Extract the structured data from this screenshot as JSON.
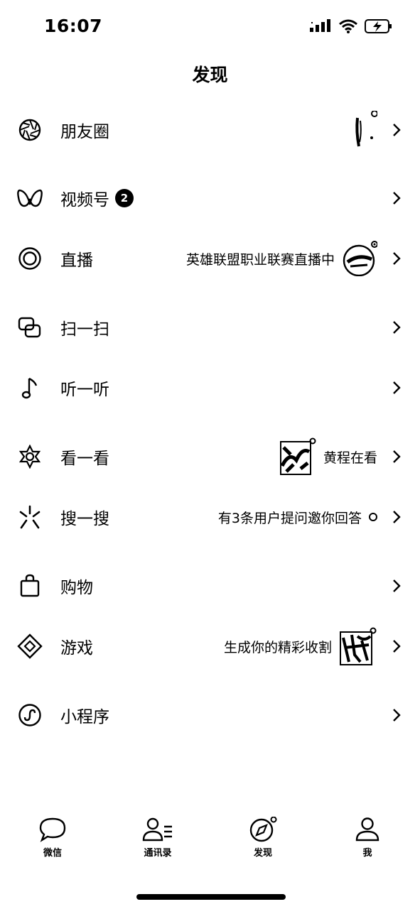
{
  "status_bar": {
    "time": "16:07"
  },
  "page": {
    "title": "发现"
  },
  "rows": [
    {
      "label": "朋友圈",
      "right_text": ""
    },
    {
      "label": "视频号",
      "badge": "2",
      "right_text": ""
    },
    {
      "label": "直播",
      "right_text": "英雄联盟职业联赛直播中"
    },
    {
      "label": "扫一扫",
      "right_text": ""
    },
    {
      "label": "听一听",
      "right_text": ""
    },
    {
      "label": "看一看",
      "right_text": "黄程在看"
    },
    {
      "label": "搜一搜",
      "right_text": "有3条用户提问邀你回答"
    },
    {
      "label": "购物",
      "right_text": ""
    },
    {
      "label": "游戏",
      "right_text": "生成你的精彩收割"
    },
    {
      "label": "小程序",
      "right_text": ""
    }
  ],
  "tabbar": {
    "items": [
      {
        "label": "微信",
        "icon": "chat-bubble-icon"
      },
      {
        "label": "通讯录",
        "icon": "contacts-icon"
      },
      {
        "label": "发现",
        "icon": "compass-icon"
      },
      {
        "label": "我",
        "icon": "person-icon"
      }
    ]
  }
}
